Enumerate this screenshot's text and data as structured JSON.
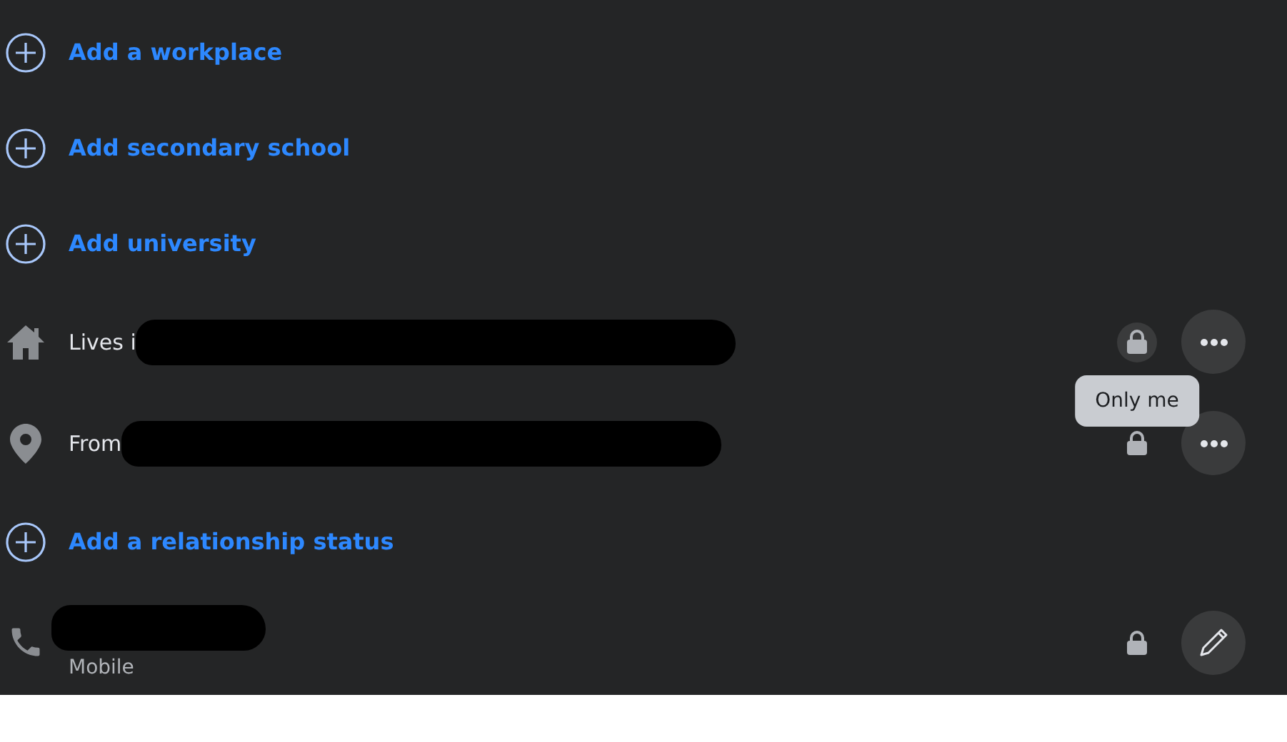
{
  "rows": [
    {
      "kind": "add",
      "label": "Add a workplace"
    },
    {
      "kind": "add",
      "label": "Add secondary school"
    },
    {
      "kind": "add",
      "label": "Add university"
    },
    {
      "kind": "info",
      "label": "Lives i",
      "redacted": true,
      "lock_hovered": true,
      "tooltip": "Only me"
    },
    {
      "kind": "info",
      "label": "From",
      "redacted": true,
      "lock_hovered": false
    },
    {
      "kind": "add",
      "label": "Add a relationship status"
    },
    {
      "kind": "contact",
      "redacted": true,
      "sublabel": "Mobile",
      "lock_hovered": false
    }
  ]
}
